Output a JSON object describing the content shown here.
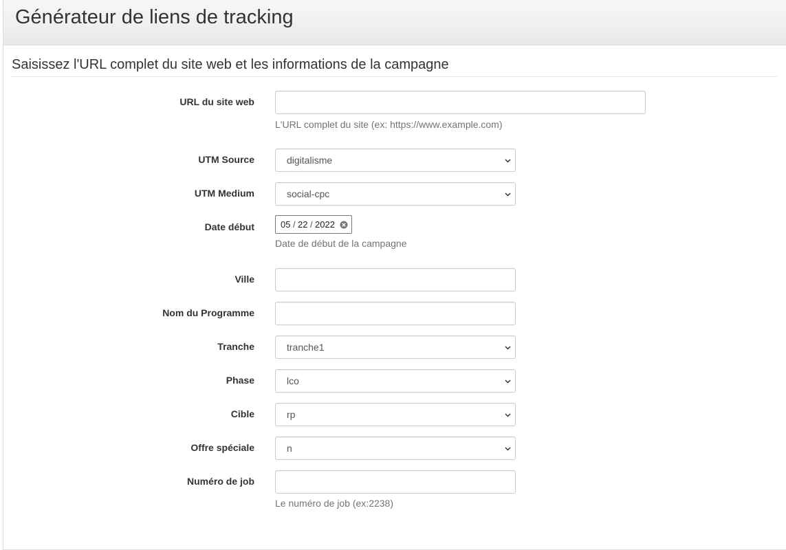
{
  "header": {
    "title": "Générateur de liens de tracking"
  },
  "section": {
    "title": "Saisissez l'URL complet du site web et les informations de la campagne"
  },
  "form": {
    "url": {
      "label": "URL du site web",
      "value": "",
      "help": "L'URL complet du site (ex: https://www.example.com)"
    },
    "utm_source": {
      "label": "UTM Source",
      "selected": "digitalisme"
    },
    "utm_medium": {
      "label": "UTM Medium",
      "selected": "social-cpc"
    },
    "date_debut": {
      "label": "Date début",
      "month": "05",
      "day": "22",
      "year": "2022",
      "separator": "/",
      "help": "Date de début de la campagne"
    },
    "ville": {
      "label": "Ville",
      "value": ""
    },
    "nom_programme": {
      "label": "Nom du Programme",
      "value": ""
    },
    "tranche": {
      "label": "Tranche",
      "selected": "tranche1"
    },
    "phase": {
      "label": "Phase",
      "selected": "lco"
    },
    "cible": {
      "label": "Cible",
      "selected": "rp"
    },
    "offre_speciale": {
      "label": "Offre spéciale",
      "selected": "n"
    },
    "numero_job": {
      "label": "Numéro de job",
      "value": "",
      "help": "Le numéro de job (ex:2238)"
    }
  },
  "icons": {
    "select_chevron": "chevron-down-icon",
    "date_clear": "clear-circle-icon"
  },
  "colors": {
    "header_bg": "#efefef",
    "border": "#cccccc",
    "help_text": "#737373",
    "label_text": "#333333"
  }
}
